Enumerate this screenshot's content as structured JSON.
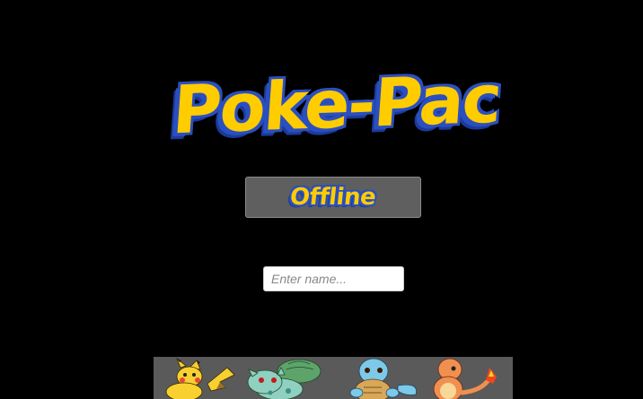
{
  "game": {
    "title": "Poke-Pac"
  },
  "menu": {
    "offline_label": "Offline"
  },
  "name_input": {
    "value": "",
    "placeholder": "Enter name..."
  },
  "banner": {
    "characters": [
      "pikachu-icon",
      "bulbasaur-icon",
      "squirtle-icon",
      "charmander-icon"
    ]
  },
  "colors": {
    "background": "#000000",
    "logo_fill": "#ffcc00",
    "logo_outline": "#2a4fbf",
    "button_bg": "#5f5f5f",
    "banner_bg": "#5a5a5a"
  }
}
